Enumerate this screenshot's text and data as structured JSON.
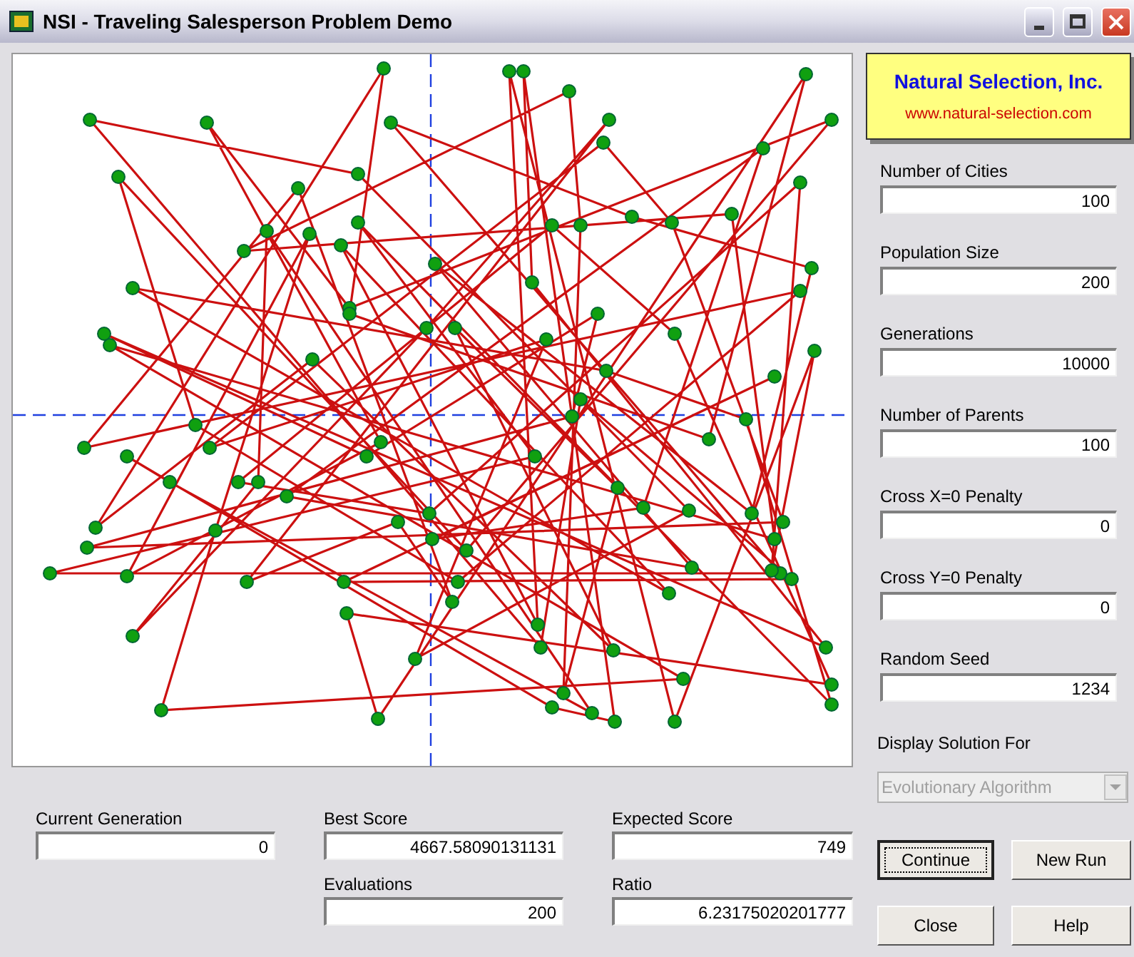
{
  "window": {
    "title": "NSI - Traveling Salesperson Problem Demo"
  },
  "logo": {
    "name": "Natural Selection, Inc.",
    "url": "www.natural-selection.com"
  },
  "settings": [
    {
      "label": "Number of Cities",
      "value": "100"
    },
    {
      "label": "Population Size",
      "value": "200"
    },
    {
      "label": "Generations",
      "value": "10000"
    },
    {
      "label": "Number of Parents",
      "value": "100"
    },
    {
      "label": "Cross X=0 Penalty",
      "value": "0"
    },
    {
      "label": "Cross Y=0 Penalty",
      "value": "0"
    },
    {
      "label": "Random Seed",
      "value": "1234"
    }
  ],
  "display_solution": {
    "label": "Display Solution For",
    "value": "Evolutionary Algorithm",
    "disabled": true
  },
  "buttons": [
    {
      "label": "Continue",
      "focused": true
    },
    {
      "label": "New Run",
      "focused": false
    },
    {
      "label": "Close",
      "focused": false
    },
    {
      "label": "Help",
      "focused": false
    }
  ],
  "results": [
    {
      "label": "Current Generation",
      "value": "0"
    },
    {
      "label": "Best Score",
      "value": "4667.58090131131"
    },
    {
      "label": "Expected Score",
      "value": "749"
    },
    {
      "label": "Evaluations",
      "value": "200"
    },
    {
      "label": "Ratio",
      "value": "6.23175020201777"
    }
  ]
}
